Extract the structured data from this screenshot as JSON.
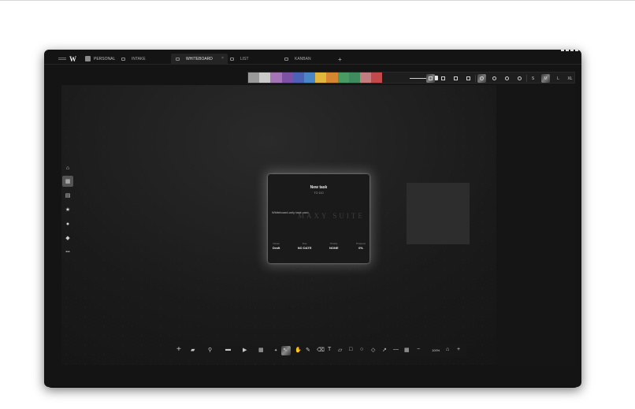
{
  "app": {
    "logo": "W",
    "workspace": "PERSONAL"
  },
  "tabs": [
    {
      "label": "INTAKE"
    },
    {
      "label": "WHITEBOARD",
      "close": "×"
    },
    {
      "label": "LIST"
    },
    {
      "label": "KANBAN"
    }
  ],
  "add_tab": "+",
  "toolbar": {
    "colors": [
      "#9a9a9a",
      "#c9c9c9",
      "#a474b4",
      "#7d52a6",
      "#4e61b6",
      "#4a86c6",
      "#e0b63c",
      "#d58630",
      "#4a9b63",
      "#3f8a5f",
      "#c37c80",
      "#c24a4a"
    ],
    "sizes": [
      "S",
      "M",
      "L",
      "XL"
    ],
    "selected_size": "M"
  },
  "sidebar": {
    "items": [
      "home-icon",
      "grid-icon",
      "calendar-icon",
      "star-icon",
      "user-icon",
      "layers-icon",
      "more-icon"
    ],
    "selected": "grid-icon",
    "more": "•••"
  },
  "card": {
    "title": "New task",
    "status": "TO DO",
    "description": "Whiteboard-only task card.",
    "watermark": "MAXY SUITE",
    "fields": [
      {
        "label": "Owner",
        "value": "Draft"
      },
      {
        "label": "Due",
        "value": "NO DATE"
      },
      {
        "label": "Priority",
        "value": "NONE"
      },
      {
        "label": "Progress",
        "value": "0%"
      }
    ]
  },
  "bottom_toolbar": {
    "zoom": "100%",
    "zoom_out": "−",
    "zoom_in": "+"
  }
}
